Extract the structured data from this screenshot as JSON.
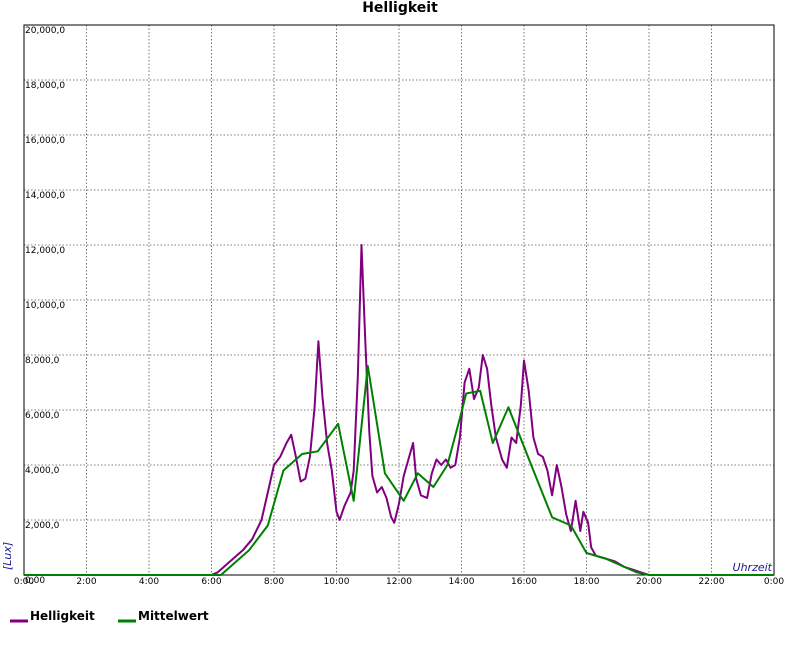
{
  "chart_data": {
    "type": "line",
    "title": "Helligkeit",
    "ylabel": "[Lux]",
    "xlabel": "Uhrzeit",
    "x_ticks": [
      "0:00",
      "2:00",
      "4:00",
      "6:00",
      "8:00",
      "10:00",
      "12:00",
      "14:00",
      "16:00",
      "18:00",
      "20:00",
      "22:00",
      "0:00"
    ],
    "y_ticks": [
      "0,00",
      "2,000,0",
      "4,000,0",
      "6,000,0",
      "8,000,0",
      "10,000,0",
      "12,000,0",
      "14,000,0",
      "16,000,0",
      "18,000,0",
      "20,000,0"
    ],
    "xlim": [
      0,
      24
    ],
    "ylim": [
      0,
      20000
    ],
    "grid": true,
    "legend_position": "bottom-left",
    "series": [
      {
        "name": "Helligkeit",
        "color": "#800080",
        "points": [
          [
            0,
            0
          ],
          [
            6.0,
            0
          ],
          [
            6.2,
            100
          ],
          [
            6.5,
            400
          ],
          [
            6.8,
            700
          ],
          [
            7.0,
            900
          ],
          [
            7.3,
            1300
          ],
          [
            7.6,
            2000
          ],
          [
            7.8,
            3000
          ],
          [
            8.0,
            4000
          ],
          [
            8.2,
            4300
          ],
          [
            8.4,
            4800
          ],
          [
            8.55,
            5100
          ],
          [
            8.7,
            4300
          ],
          [
            8.85,
            3400
          ],
          [
            9.0,
            3500
          ],
          [
            9.15,
            4300
          ],
          [
            9.3,
            6100
          ],
          [
            9.42,
            8500
          ],
          [
            9.55,
            6500
          ],
          [
            9.7,
            4800
          ],
          [
            9.85,
            3800
          ],
          [
            10.0,
            2300
          ],
          [
            10.1,
            2000
          ],
          [
            10.25,
            2500
          ],
          [
            10.45,
            3000
          ],
          [
            10.55,
            3800
          ],
          [
            10.68,
            7200
          ],
          [
            10.8,
            12000
          ],
          [
            10.92,
            8500
          ],
          [
            11.05,
            5200
          ],
          [
            11.15,
            3600
          ],
          [
            11.3,
            3000
          ],
          [
            11.45,
            3200
          ],
          [
            11.6,
            2800
          ],
          [
            11.75,
            2100
          ],
          [
            11.85,
            1900
          ],
          [
            12.0,
            2600
          ],
          [
            12.15,
            3600
          ],
          [
            12.3,
            4200
          ],
          [
            12.45,
            4800
          ],
          [
            12.55,
            3500
          ],
          [
            12.7,
            2900
          ],
          [
            12.9,
            2800
          ],
          [
            13.05,
            3700
          ],
          [
            13.2,
            4200
          ],
          [
            13.35,
            4000
          ],
          [
            13.5,
            4200
          ],
          [
            13.65,
            3900
          ],
          [
            13.8,
            4000
          ],
          [
            13.95,
            5000
          ],
          [
            14.1,
            7000
          ],
          [
            14.25,
            7500
          ],
          [
            14.4,
            6400
          ],
          [
            14.55,
            6800
          ],
          [
            14.68,
            8000
          ],
          [
            14.82,
            7500
          ],
          [
            14.95,
            6200
          ],
          [
            15.1,
            5000
          ],
          [
            15.3,
            4200
          ],
          [
            15.45,
            3900
          ],
          [
            15.6,
            5000
          ],
          [
            15.75,
            4800
          ],
          [
            15.9,
            6200
          ],
          [
            16.0,
            7800
          ],
          [
            16.15,
            6700
          ],
          [
            16.3,
            5000
          ],
          [
            16.45,
            4400
          ],
          [
            16.6,
            4300
          ],
          [
            16.75,
            3800
          ],
          [
            16.9,
            2900
          ],
          [
            17.05,
            4000
          ],
          [
            17.2,
            3200
          ],
          [
            17.35,
            2200
          ],
          [
            17.5,
            1600
          ],
          [
            17.65,
            2700
          ],
          [
            17.8,
            1600
          ],
          [
            17.9,
            2300
          ],
          [
            18.05,
            1900
          ],
          [
            18.15,
            1000
          ],
          [
            18.3,
            700
          ],
          [
            18.6,
            600
          ],
          [
            18.9,
            500
          ],
          [
            19.2,
            300
          ],
          [
            19.6,
            150
          ],
          [
            20.0,
            0
          ],
          [
            24,
            0
          ]
        ]
      },
      {
        "name": "Mittelwert",
        "color": "#008000",
        "points": [
          [
            0,
            0
          ],
          [
            6.3,
            0
          ],
          [
            6.7,
            400
          ],
          [
            7.2,
            900
          ],
          [
            7.8,
            1800
          ],
          [
            8.3,
            3800
          ],
          [
            8.9,
            4400
          ],
          [
            9.4,
            4500
          ],
          [
            10.05,
            5500
          ],
          [
            10.55,
            2700
          ],
          [
            11.0,
            7600
          ],
          [
            11.55,
            3700
          ],
          [
            12.15,
            2700
          ],
          [
            12.6,
            3700
          ],
          [
            13.1,
            3200
          ],
          [
            13.55,
            4000
          ],
          [
            13.95,
            5700
          ],
          [
            14.15,
            6600
          ],
          [
            14.6,
            6700
          ],
          [
            15.0,
            4800
          ],
          [
            15.5,
            6100
          ],
          [
            16.3,
            3800
          ],
          [
            16.9,
            2100
          ],
          [
            17.5,
            1800
          ],
          [
            18.0,
            800
          ],
          [
            18.6,
            600
          ],
          [
            19.6,
            100
          ],
          [
            20.0,
            0
          ],
          [
            24,
            0
          ]
        ]
      }
    ]
  }
}
